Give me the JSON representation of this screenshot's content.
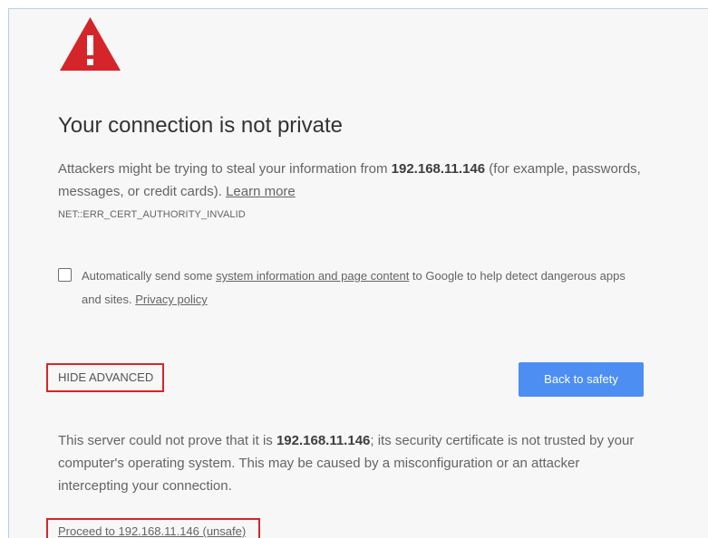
{
  "colors": {
    "warning_red": "#d6252a",
    "primary_blue": "#4c8ef2",
    "page_bg": "#f7f7f7"
  },
  "icons": {
    "warning": "warning-triangle-icon"
  },
  "heading": "Your connection is not private",
  "intro": {
    "before_host": "Attackers might be trying to steal your information from ",
    "host": "192.168.11.146",
    "after_host": " (for example, passwords, messages, or credit cards). ",
    "learn_more": "Learn more"
  },
  "error_code": "NET::ERR_CERT_AUTHORITY_INVALID",
  "report_option": {
    "checked": false,
    "text_before": "Automatically send some ",
    "link1": "system information and page content",
    "text_middle": " to Google to help detect dangerous apps and sites. ",
    "link2": "Privacy policy"
  },
  "buttons": {
    "hide_advanced": "HIDE ADVANCED",
    "back_to_safety": "Back to safety"
  },
  "details": {
    "before_host": "This server could not prove that it is ",
    "host": "192.168.11.146",
    "after_host": "; its security certificate is not trusted by your computer's operating system. This may be caused by a misconfiguration or an attacker intercepting your connection."
  },
  "proceed_link": "Proceed to 192.168.11.146 (unsafe)"
}
